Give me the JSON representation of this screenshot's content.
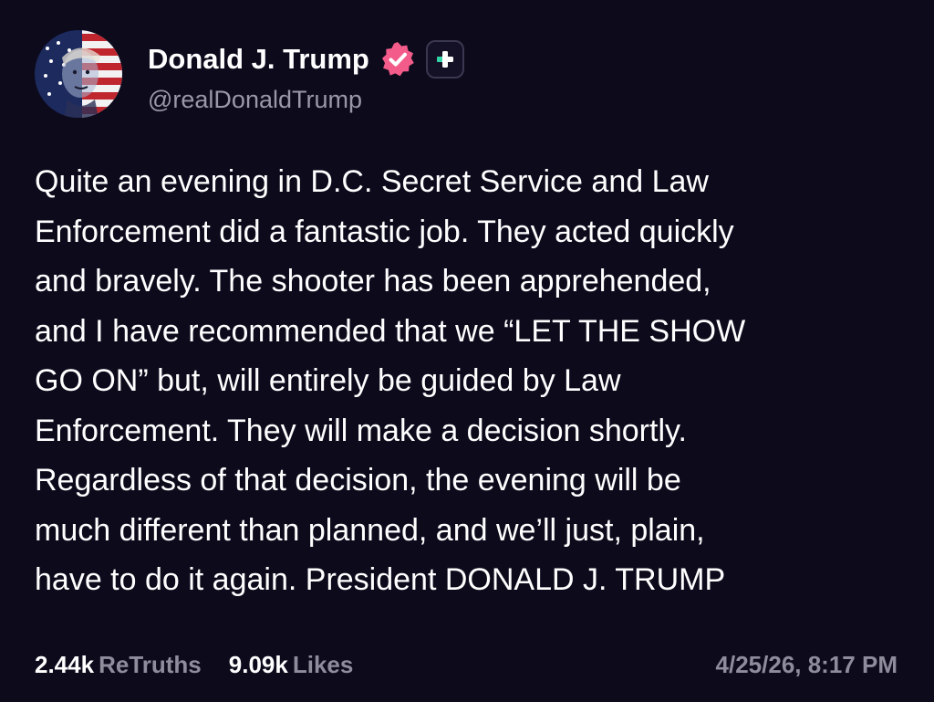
{
  "author": {
    "display_name": "Donald J. Trump",
    "handle": "@realDonaldTrump",
    "avatar_icon": "flag-portrait-avatar",
    "verified_icon": "verified-badge-icon",
    "badge_icon": "plus-badge-icon"
  },
  "post": {
    "text": "Quite an evening in D.C. Secret Service and Law\nEnforcement did a fantastic job. They acted quickly\nand bravely. The shooter has been apprehended,\nand I have recommended that we “LET THE SHOW\nGO ON” but, will entirely be guided by Law\nEnforcement. They will make a decision shortly.\nRegardless of that decision, the evening will be\nmuch different than planned, and we’ll just, plain,\nhave to do it again. President DONALD J. TRUMP"
  },
  "stats": {
    "retruths_count": "2.44k",
    "retruths_label": "ReTruths",
    "likes_count": "9.09k",
    "likes_label": "Likes"
  },
  "timestamp": "4/25/26, 8:17 PM",
  "colors": {
    "background": "#0d0a1c",
    "text_primary": "#ffffff",
    "text_secondary": "#8f8d9c",
    "verified": "#f35b8a",
    "plus_badge": "#ffffff"
  }
}
